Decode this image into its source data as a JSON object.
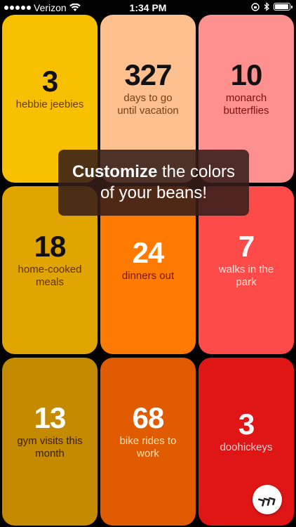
{
  "status_bar": {
    "carrier": "Verizon",
    "time": "1:34 PM"
  },
  "beans": [
    {
      "count": "3",
      "label": "hebbie jeebies",
      "bg": "#F7C000",
      "count_color": "#111111",
      "label_color": "#6B3A00"
    },
    {
      "count": "327",
      "label": "days to go until vacation",
      "bg": "#FFC08F",
      "count_color": "#111111",
      "label_color": "#7A3F10"
    },
    {
      "count": "10",
      "label": "monarch butterflies",
      "bg": "#FF9090",
      "count_color": "#111111",
      "label_color": "#7A1010"
    },
    {
      "count": "18",
      "label": "home-cooked meals",
      "bg": "#E0A500",
      "count_color": "#111111",
      "label_color": "#5C3200"
    },
    {
      "count": "24",
      "label": "dinners out",
      "bg": "#FF7A00",
      "count_color": "#FFFFFF",
      "label_color": "#7A1500"
    },
    {
      "count": "7",
      "label": "walks in the park",
      "bg": "#FF4A4A",
      "count_color": "#FFFFFF",
      "label_color": "#FFE0D8"
    },
    {
      "count": "13",
      "label": "gym visits this month",
      "bg": "#C48A00",
      "count_color": "#FFFFFF",
      "label_color": "#3A1E00"
    },
    {
      "count": "68",
      "label": "bike rides to work",
      "bg": "#E05A00",
      "count_color": "#FFFFFF",
      "label_color": "#FFE0B0"
    },
    {
      "count": "3",
      "label": "doohickeys",
      "bg": "#E01515",
      "count_color": "#FFFFFF",
      "label_color": "#FFD0D0"
    }
  ],
  "toast": {
    "bold": "Customize",
    "rest": " the colors of your beans!"
  },
  "icons": {
    "fab": "double-chevron-icon"
  }
}
